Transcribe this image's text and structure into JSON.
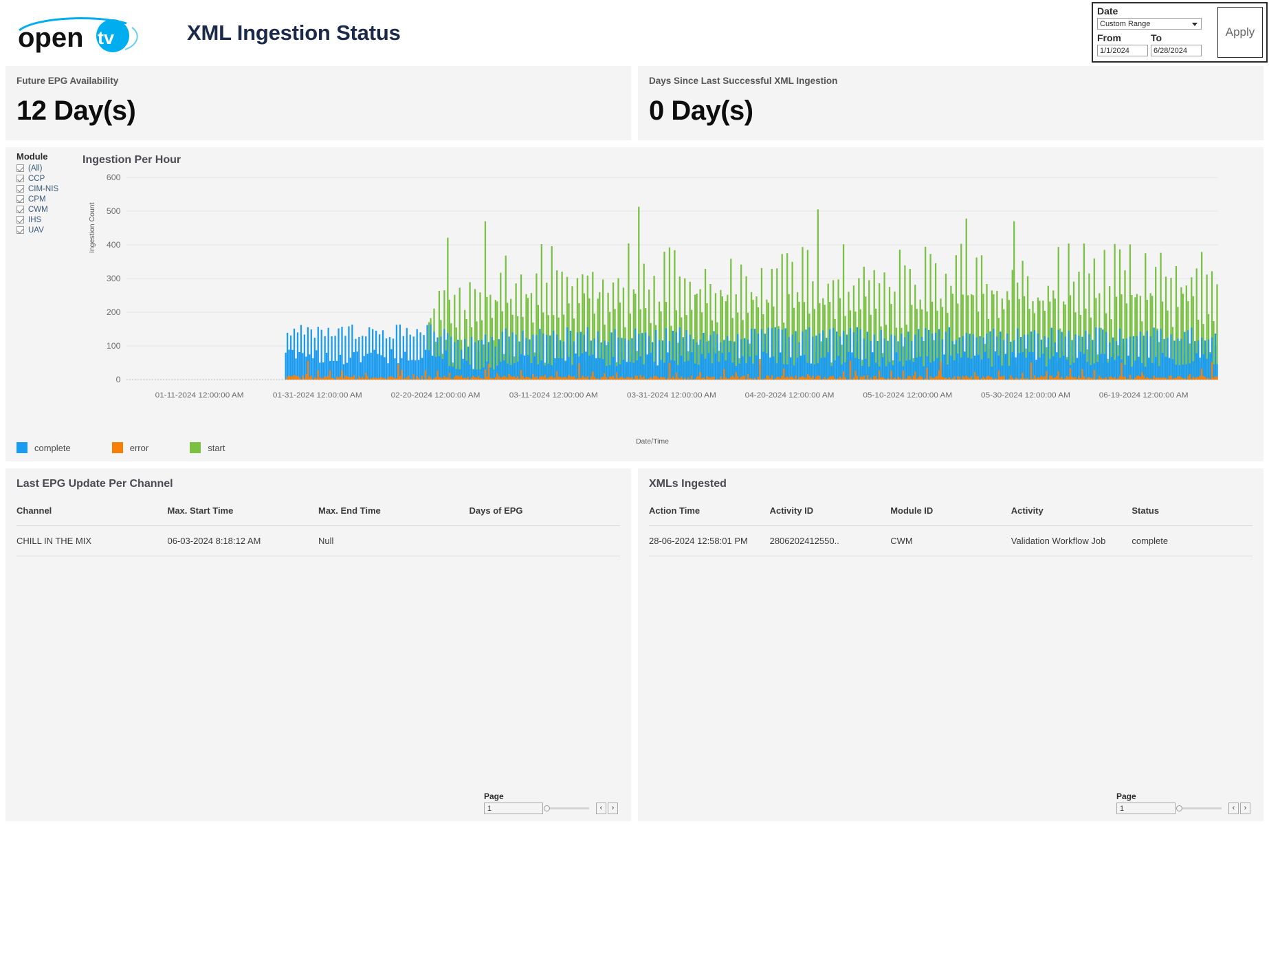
{
  "header": {
    "logo_text": "opentv",
    "title": "XML Ingestion Status"
  },
  "date_control": {
    "date_label": "Date",
    "range_value": "Custom Range",
    "from_label": "From",
    "to_label": "To",
    "from_value": "1/1/2024",
    "to_value": "6/28/2024",
    "apply_label": "Apply"
  },
  "kpis": [
    {
      "title": "Future EPG Availability",
      "value": "12 Day(s)"
    },
    {
      "title": "Days Since Last Successful XML Ingestion",
      "value": "0 Day(s)"
    }
  ],
  "module_filter": {
    "title": "Module",
    "items": [
      {
        "label": "(All)",
        "checked": true
      },
      {
        "label": "CCP",
        "checked": true
      },
      {
        "label": "CIM-NIS",
        "checked": true
      },
      {
        "label": "CPM",
        "checked": true
      },
      {
        "label": "CWM",
        "checked": true
      },
      {
        "label": "IHS",
        "checked": true
      },
      {
        "label": "UAV",
        "checked": true
      }
    ]
  },
  "chart_data": {
    "type": "line",
    "title": "Ingestion Per Hour",
    "xlabel": "Date/Time",
    "ylabel": "Ingestion Count",
    "ylim": [
      0,
      600
    ],
    "yticks": [
      0,
      100,
      200,
      300,
      400,
      500,
      600
    ],
    "grid": true,
    "legend_position": "bottom-left",
    "xtick_labels": [
      "01-11-2024 12:00:00 AM",
      "01-31-2024 12:00:00 AM",
      "02-20-2024 12:00:00 AM",
      "03-11-2024 12:00:00 AM",
      "03-31-2024 12:00:00 AM",
      "04-20-2024 12:00:00 AM",
      "05-10-2024 12:00:00 AM",
      "05-30-2024 12:00:00 AM",
      "06-19-2024 12:00:00 AM"
    ],
    "x_range_start": "01-01-2024 12:00:00 AM",
    "x_range_end": "06-28-2024 12:00:00 PM",
    "series": [
      {
        "name": "complete",
        "color": "#1b9bf0",
        "description": "Hourly completed ingestions; dense oscillation roughly between 40 and 160 across the whole range, mean about 95, occasional peaks to 170.",
        "baseline": 95,
        "min": 30,
        "max": 175
      },
      {
        "name": "error",
        "color": "#f77f07",
        "description": "Hourly errors; near zero for the whole range with small bumps up to about 45 and isolated spikes near 90.",
        "baseline": 6,
        "min": 0,
        "max": 95
      },
      {
        "name": "start",
        "color": "#7ac143",
        "description": "Hourly started ingestions; negligible before 02-14-2024 then large repeated daily spikes between 150 and 420 with outliers at 580, 513, 505, 490, 478, 470.",
        "baseline": 190,
        "min": 0,
        "max": 585,
        "starts_at": "02-14-2024"
      }
    ]
  },
  "legend": [
    {
      "label": "complete",
      "color": "#1b9bf0"
    },
    {
      "label": "error",
      "color": "#f77f07"
    },
    {
      "label": "start",
      "color": "#7ac143"
    }
  ],
  "left_table": {
    "title": "Last EPG Update Per Channel",
    "columns": [
      "Channel",
      "Max. Start Time",
      "Max. End Time",
      "Days of EPG"
    ],
    "rows": [
      [
        "CHILL IN THE MIX",
        "06-03-2024 8:18:12 AM",
        "Null",
        ""
      ]
    ],
    "pager": {
      "label": "Page",
      "value": "1",
      "prev": "‹",
      "next": "›"
    }
  },
  "right_table": {
    "title": "XMLs Ingested",
    "columns": [
      "Action Time",
      "Activity ID",
      "Module ID",
      "Activity",
      "Status"
    ],
    "rows": [
      [
        "28-06-2024 12:58:01 PM",
        "2806202412550..",
        "CWM",
        "Validation Workflow Job",
        "complete"
      ]
    ],
    "pager": {
      "label": "Page",
      "value": "1",
      "prev": "‹",
      "next": "›"
    }
  }
}
